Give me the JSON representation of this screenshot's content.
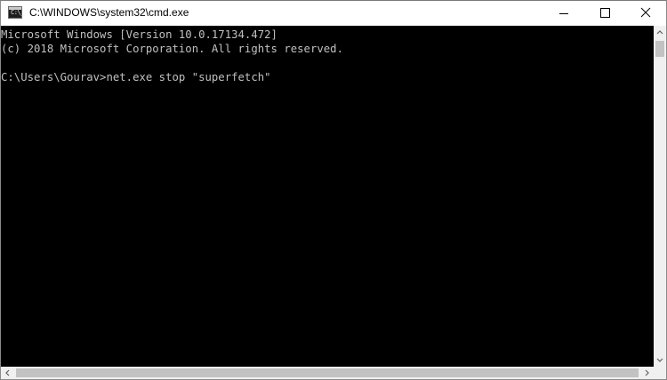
{
  "window": {
    "title": "C:\\WINDOWS\\system32\\cmd.exe",
    "app_icon_text": "C:\\_"
  },
  "caption_buttons": {
    "minimize": "minimize-icon",
    "maximize": "maximize-icon",
    "close": "close-icon"
  },
  "console": {
    "lines": [
      "Microsoft Windows [Version 10.0.17134.472]",
      "(c) 2018 Microsoft Corporation. All rights reserved.",
      "C:\\Users\\Gourav>net.exe stop \"superfetch\""
    ],
    "background": "#000000",
    "foreground": "#c0c0c0"
  },
  "scrollbars": {
    "vertical": {
      "up": "arrow-up-icon",
      "down": "arrow-down-icon"
    },
    "horizontal": {
      "left": "arrow-left-icon",
      "right": "arrow-right-icon"
    }
  }
}
